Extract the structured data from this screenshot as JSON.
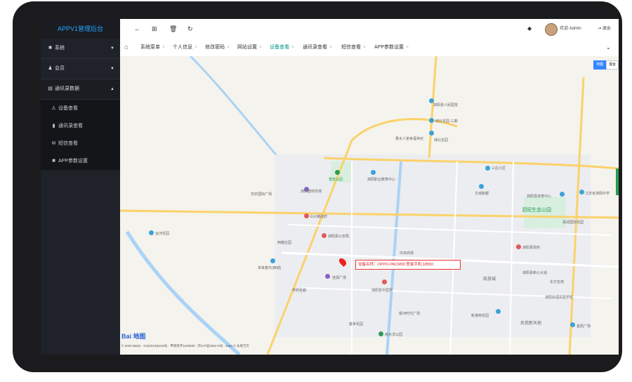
{
  "sidebar": {
    "brand": "APPV1管理后台",
    "menus": [
      {
        "label": "系统",
        "icon": "gear-icon"
      },
      {
        "label": "会员",
        "icon": "users-icon"
      },
      {
        "label": "通讯录数据",
        "icon": "card-icon"
      }
    ],
    "sub": [
      {
        "label": "设备查看",
        "icon": "user-icon"
      },
      {
        "label": "通讯录查看",
        "icon": "book-icon"
      },
      {
        "label": "短信查看",
        "icon": "mail-icon"
      },
      {
        "label": "APP参数设置",
        "icon": "gear-icon"
      }
    ]
  },
  "header": {
    "welcome": "欢迎 Admin",
    "logout": "退出"
  },
  "tabs": [
    "系统菜单",
    "个人信息",
    "修改密码",
    "网站设置",
    "设备查看",
    "通讯录查看",
    "短信查看",
    "APP参数设置"
  ],
  "map": {
    "infobox": "设备名称：OPPO-PACM00 登录手机:18550",
    "maptype": [
      "地图",
      "混合"
    ],
    "logo": "Bai 地图",
    "copyright": "© 2020 Baidu - GS(2019)5218号 - 甲测资字1100930 - 京ICP证030173号 - Data © 长地万方",
    "labels": [
      {
        "t": "泗阳县人民医院",
        "c": "#666"
      },
      {
        "t": "城北花园-三期",
        "c": "#666"
      },
      {
        "t": "香水人家幸福世纪",
        "c": "#666"
      },
      {
        "t": "城北花园",
        "c": "#666"
      },
      {
        "t": "三庄小区",
        "c": "#666"
      },
      {
        "t": "泗阳职业教育中心",
        "c": "#666"
      },
      {
        "t": "景宏公园",
        "c": "#2a9b56"
      },
      {
        "t": "泗阳建材市场",
        "c": "#666"
      },
      {
        "t": "苏农国际广场",
        "c": "#666"
      },
      {
        "t": "泗阳县体育中心",
        "c": "#666"
      },
      {
        "t": "泗阳生态公园",
        "c": "#2a9b56"
      },
      {
        "t": "江苏省泗阳中学",
        "c": "#666"
      },
      {
        "t": "众兴镇政府",
        "c": "#666"
      },
      {
        "t": "文城新都",
        "c": "#666"
      },
      {
        "t": "翡润国际花园",
        "c": "#666"
      },
      {
        "t": "运河花园",
        "c": "#666"
      },
      {
        "t": "泗阳县公安局",
        "c": "#666"
      },
      {
        "t": "泗阳县政府",
        "c": "#666"
      },
      {
        "t": "西康庄园",
        "c": "#666"
      },
      {
        "t": "中央商场",
        "c": "#666"
      },
      {
        "t": "泗阳县新公大道",
        "c": "#666"
      },
      {
        "t": "未来春天(西城)",
        "c": "#666"
      },
      {
        "t": "佳源广场",
        "c": "#666"
      },
      {
        "t": "东方名苑",
        "c": "#666"
      },
      {
        "t": "泗阳县中医院",
        "c": "#666"
      },
      {
        "t": "银河时代广场",
        "c": "#666"
      },
      {
        "t": "新港苑花园",
        "c": "#666"
      },
      {
        "t": "泗阳双语实验学校",
        "c": "#666"
      },
      {
        "t": "学府名都",
        "c": "#666"
      },
      {
        "t": "西大洋公园",
        "c": "#666"
      },
      {
        "t": "盛世花园",
        "c": "#666"
      },
      {
        "t": "名苑新天地",
        "c": "#666"
      },
      {
        "t": "金凯广场",
        "c": "#666"
      },
      {
        "t": "凯旋城",
        "c": "#666"
      }
    ]
  }
}
